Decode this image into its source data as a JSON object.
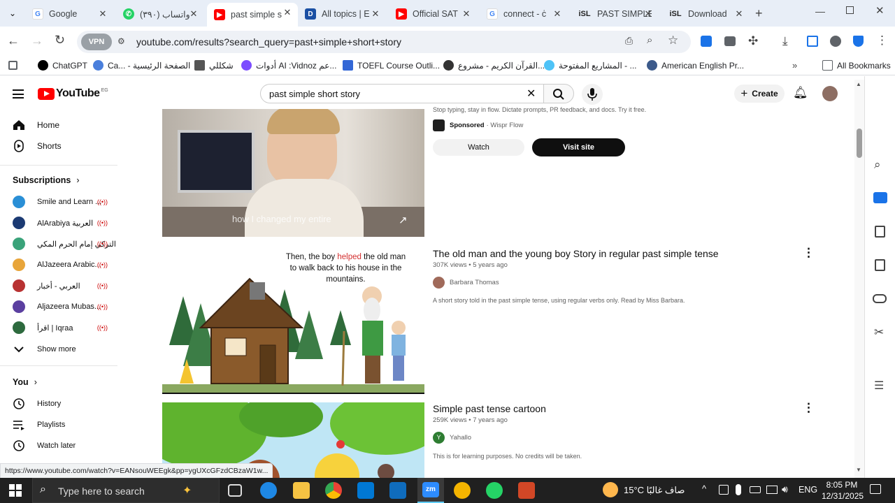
{
  "tabs": [
    {
      "title": "Google",
      "icon": "google-icon",
      "color": "#4285f4"
    },
    {
      "title": "(٣٩٠) واتساب",
      "icon": "whatsapp-icon",
      "color": "#25d366"
    },
    {
      "title": "past simple s",
      "icon": "youtube-icon",
      "color": "#ff0000"
    },
    {
      "title": "All topics | E",
      "icon": "doc-icon",
      "color": "#1a4fa3"
    },
    {
      "title": "Official SAT",
      "icon": "youtube-icon",
      "color": "#ff0000"
    },
    {
      "title": "connect - ċ",
      "icon": "google-icon",
      "color": "#4285f4"
    },
    {
      "title": "PAST SIMPLE",
      "icon": "isl-icon",
      "color": "#222222"
    },
    {
      "title": "Download",
      "icon": "isl-icon",
      "color": "#222222"
    }
  ],
  "url": "youtube.com/results?search_query=past+simple+short+story",
  "bookmarks": [
    "ChatGPT",
    "Ca... - الصفحة الرئيسية",
    "شكللي",
    "أدوات AI :Vidnoz عم...",
    "TOEFL Course Outli...",
    "القرآن الكريم - مشروع...",
    "المشاريع المفتوحة - ...",
    "American English Pr..."
  ],
  "all_bookmarks": "All Bookmarks",
  "yt": {
    "logo": "YouTube",
    "region": "EG",
    "search_value": "past simple short story",
    "create": "Create"
  },
  "sidebar": {
    "home": "Home",
    "shorts": "Shorts",
    "subscriptions": "Subscriptions",
    "subs": [
      {
        "name": "Smile and Learn ...",
        "color": "#2a8fd6"
      },
      {
        "name": "AlArabiya العربية",
        "color": "#1b3a73"
      },
      {
        "name": "التركي إمام الحرم المكي",
        "color": "#3aa37a"
      },
      {
        "name": "AlJazeera Arabic...",
        "color": "#e8a53a"
      },
      {
        "name": "العربي - أخبار",
        "color": "#b83232"
      },
      {
        "name": "Aljazeera Mubas...",
        "color": "#5b3fa0"
      },
      {
        "name": "اقرأ | Iqraa",
        "color": "#2d6a3e"
      }
    ],
    "show_more": "Show more",
    "you": "You",
    "history": "History",
    "playlists": "Playlists",
    "watch_later": "Watch later"
  },
  "ad": {
    "desc": "Stop typing, stay in flow. Dictate prompts, PR feedback, and docs. Try it free.",
    "sponsored": "Sponsored",
    "advertiser": "· Wispr Flow",
    "watch": "Watch",
    "visit": "Visit site",
    "caption": "how I changed my entire"
  },
  "videos": [
    {
      "title": "The old man and the young boy Story in regular past simple tense",
      "views": "307K views",
      "age": "5 years ago",
      "channel": "Barbara Thomas",
      "desc": "A short story told in the past simple tense, using regular verbs only. Read by Miss Barbara.",
      "thumb_text": {
        "a": "Then, the boy ",
        "b": "helped",
        "c": " the old man",
        "d": "to walk back to his house in the",
        "e": "mountains."
      }
    },
    {
      "title": "Simple past tense cartoon",
      "views": "259K views",
      "age": "7 years ago",
      "channel": "Yahallo",
      "desc": "This is for learning purposes. No credits will be taken."
    }
  ],
  "status_url": "https://www.youtube.com/watch?v=EANsouWEEgk&pp=ygUXcGFzdCBzaW1w...",
  "taskbar": {
    "search": "Type here to search",
    "weather": "15°C  صاف غالبًا",
    "lang": "ENG",
    "time": "8:05 PM",
    "date": "12/31/2025"
  }
}
